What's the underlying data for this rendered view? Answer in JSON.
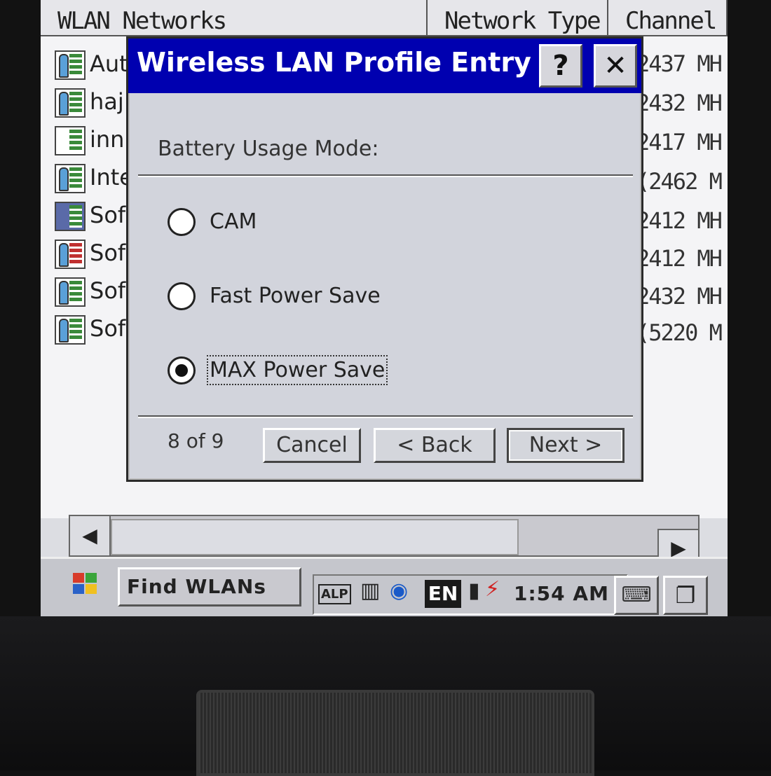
{
  "list": {
    "headers": [
      "WLAN Networks",
      "Network Type",
      "Channel"
    ],
    "rows": [
      {
        "name": "Aut",
        "channel": "2437 MH"
      },
      {
        "name": "haj",
        "channel": "2432 MH"
      },
      {
        "name": "inn",
        "channel": "2417 MH"
      },
      {
        "name": "Inte",
        "channel": "(2462 M"
      },
      {
        "name": "Sof",
        "channel": "2412 MH"
      },
      {
        "name": "Sof",
        "channel": "2412 MH"
      },
      {
        "name": "Sof",
        "channel": "2432 MH"
      },
      {
        "name": "Sof",
        "channel": "(5220 M"
      }
    ]
  },
  "dialog": {
    "title": "Wireless LAN Profile Entry",
    "help": "?",
    "close": "✕",
    "section_label": "Battery Usage Mode:",
    "options": [
      {
        "label": "CAM",
        "checked": false
      },
      {
        "label": "Fast Power Save",
        "checked": false
      },
      {
        "label": "MAX Power Save",
        "checked": true
      }
    ],
    "page_count": "8 of 9",
    "buttons": {
      "cancel": "Cancel",
      "back": "< Back",
      "next": "Next >"
    }
  },
  "taskbar": {
    "task": "Find WLANs",
    "tray_alp": "ALP",
    "tray_lang": "EN",
    "clock": "1:54 AM"
  },
  "icons": {
    "start": "windows-logo-icon",
    "keyboard": "keyboard-icon",
    "windows": "window-switch-icon"
  }
}
